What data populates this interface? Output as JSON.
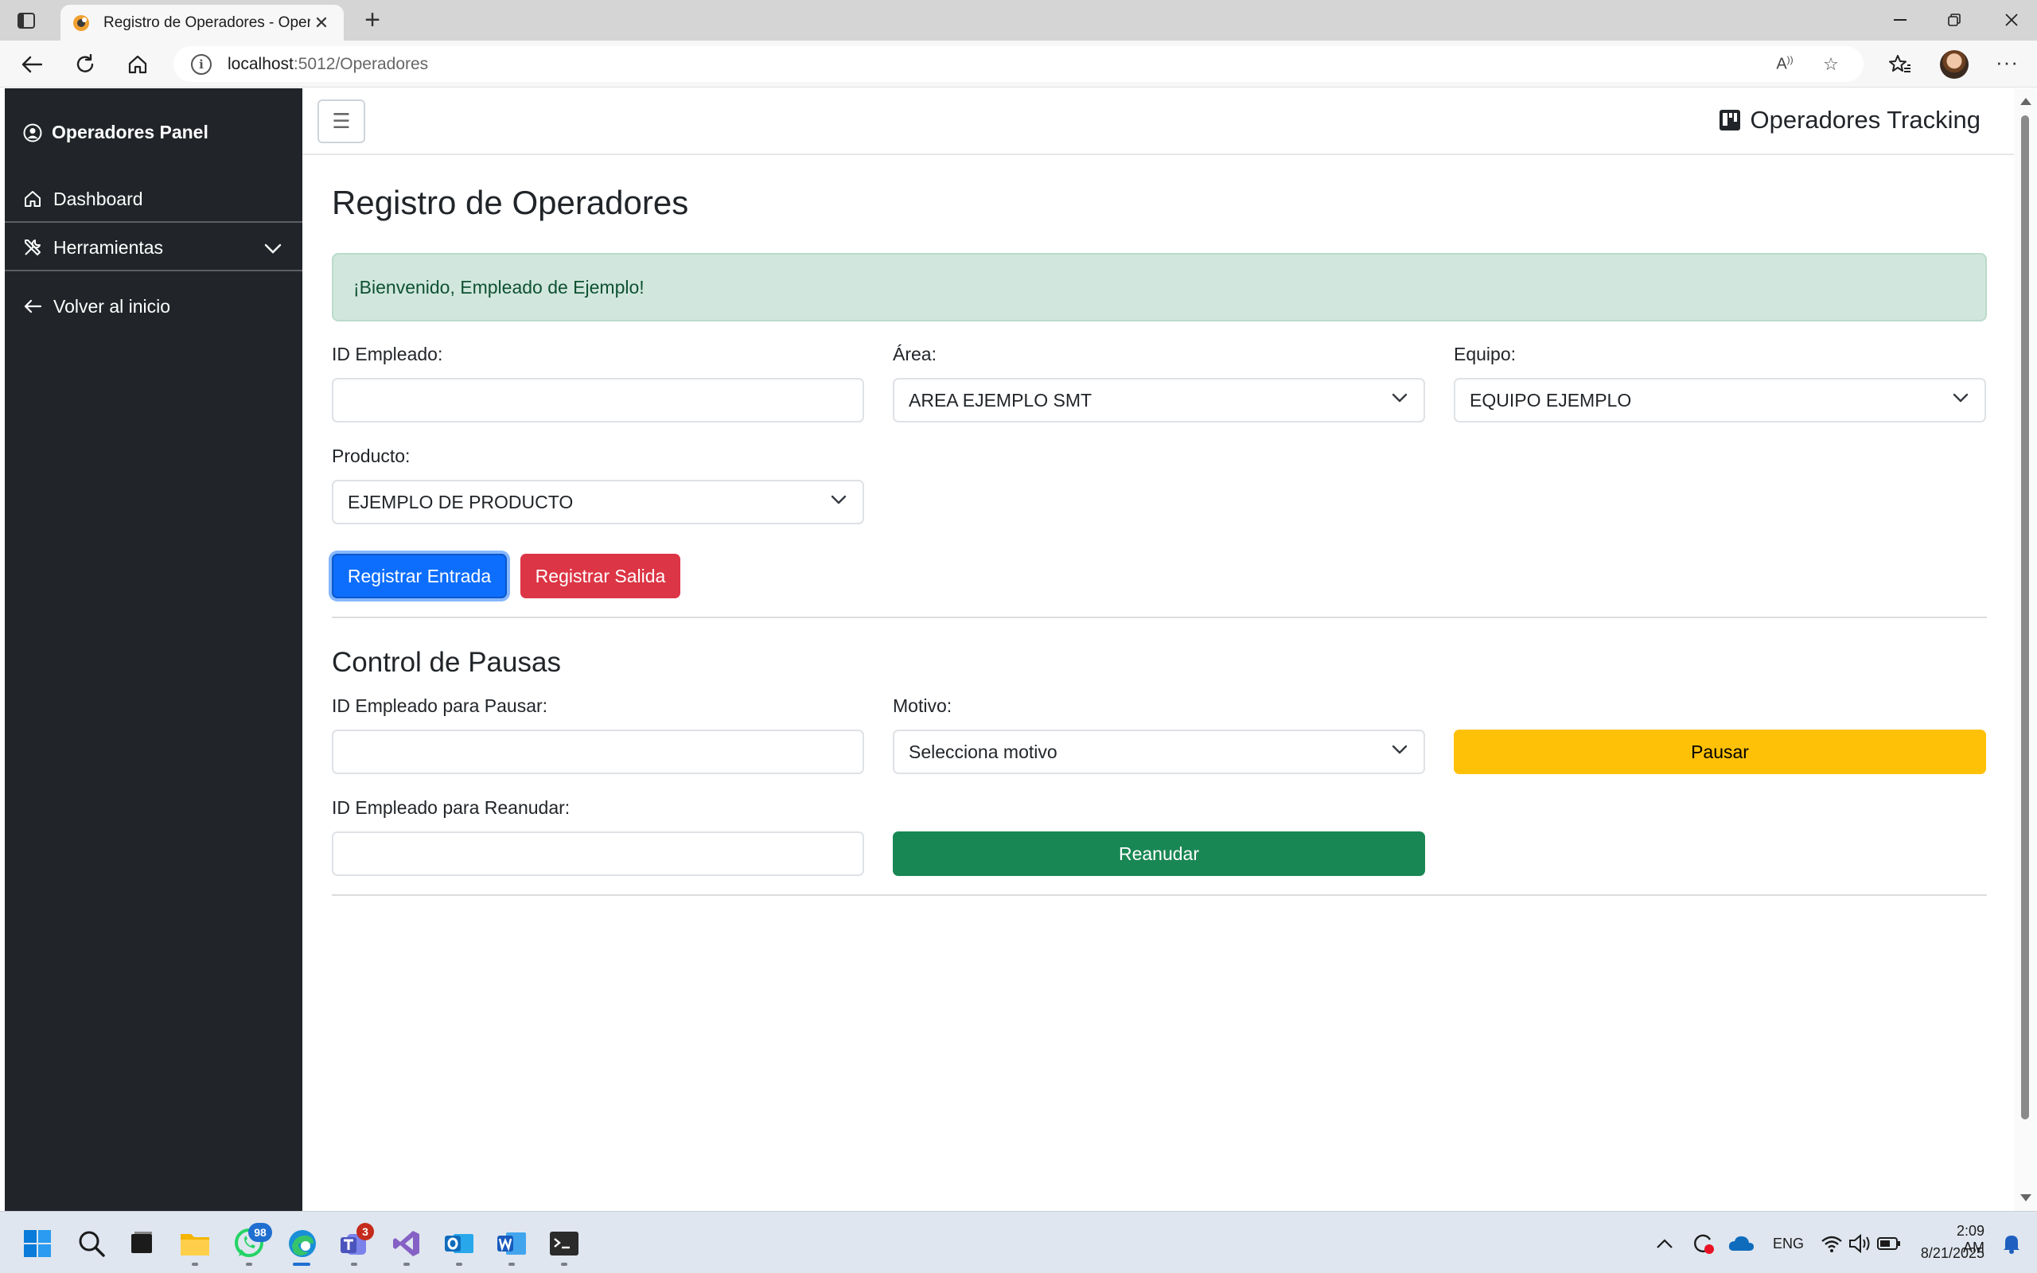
{
  "browser": {
    "tab_title": "Registro de Operadores - Operad",
    "url_host": "localhost",
    "url_path": ":5012/Operadores"
  },
  "sidebar": {
    "brand": "Operadores Panel",
    "items": [
      {
        "label": "Dashboard",
        "icon": "home-icon"
      },
      {
        "label": "Herramientas",
        "icon": "tools-icon"
      },
      {
        "label": "Volver al inicio",
        "icon": "arrow-left-icon"
      }
    ]
  },
  "topnav": {
    "toggle": "☰",
    "brand": "Operadores Tracking"
  },
  "page": {
    "title": "Registro de Operadores",
    "alert": "¡Bienvenido, Empleado de Ejemplo!"
  },
  "form": {
    "id_label": "ID Empleado:",
    "id_value": "",
    "area_label": "Área:",
    "area_value": "AREA EJEMPLO SMT",
    "equipo_label": "Equipo:",
    "equipo_value": "EQUIPO EJEMPLO",
    "producto_label": "Producto:",
    "producto_value": "EJEMPLO DE PRODUCTO",
    "entrada_btn": "Registrar Entrada",
    "salida_btn": "Registrar Salida"
  },
  "pausas": {
    "title": "Control de Pausas",
    "pause_id_label": "ID Empleado para Pausar:",
    "motivo_label": "Motivo:",
    "motivo_value": "Selecciona motivo",
    "pause_btn": "Pausar",
    "resume_id_label": "ID Empleado para Reanudar:",
    "resume_btn": "Reanudar"
  },
  "colors": {
    "sidebar_bg": "#212529",
    "primary": "#0d6efd",
    "danger": "#dc3545",
    "warning": "#ffc107",
    "success": "#198754",
    "alert_bg": "#d1e7dd"
  },
  "taskbar": {
    "whatsapp_badge": "98",
    "teams_badge": "3",
    "language": "ENG",
    "time": "2:09 AM",
    "date": "8/21/2025"
  }
}
